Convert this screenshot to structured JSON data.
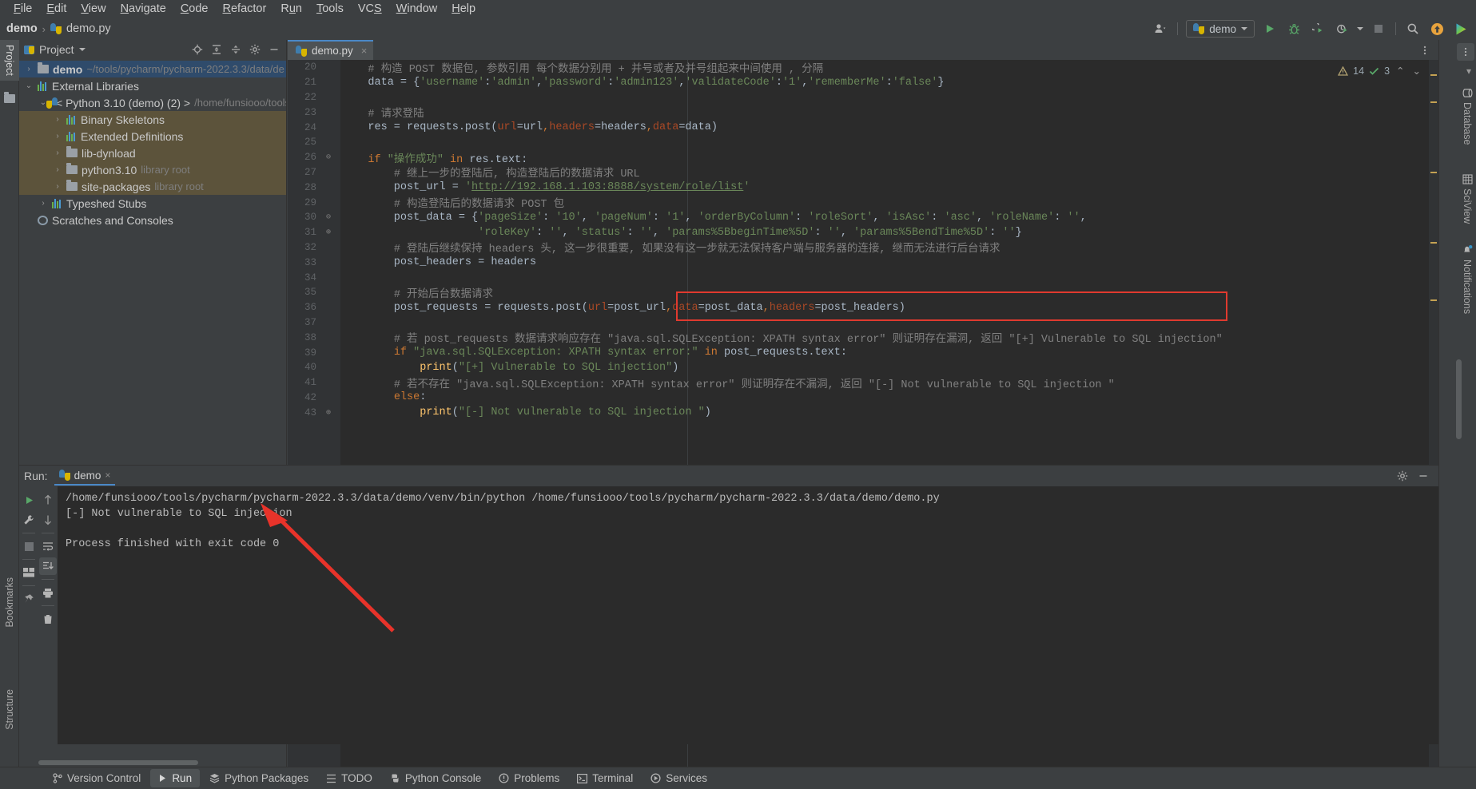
{
  "menu": {
    "items": [
      {
        "label": "File",
        "accel": "F"
      },
      {
        "label": "Edit",
        "accel": "E"
      },
      {
        "label": "View",
        "accel": "V"
      },
      {
        "label": "Navigate",
        "accel": "N"
      },
      {
        "label": "Code",
        "accel": "C"
      },
      {
        "label": "Refactor",
        "accel": "R"
      },
      {
        "label": "Run",
        "accel": "u"
      },
      {
        "label": "Tools",
        "accel": "T"
      },
      {
        "label": "VCS",
        "accel": "S"
      },
      {
        "label": "Window",
        "accel": "W"
      },
      {
        "label": "Help",
        "accel": "H"
      }
    ]
  },
  "breadcrumb": {
    "project": "demo",
    "separator": "›",
    "file": "demo.py"
  },
  "toolbar": {
    "account_icon": "account-icon",
    "run_config": "demo",
    "run_icon": "run-icon",
    "debug_icon": "debug-icon",
    "coverage_icon": "run-with-coverage-icon",
    "profile_icon": "profile-icon",
    "stop_icon": "stop-icon",
    "search_icon": "search-icon",
    "update_icon": "update-icon",
    "ai_icon": "ai-assistant-icon"
  },
  "left_strip": {
    "top": "Project",
    "bookmarks": "Bookmarks",
    "structure": "Structure"
  },
  "right_strip": {
    "database": "Database",
    "sciview": "SciView",
    "notifications": "Notifications"
  },
  "project_panel": {
    "title": "Project",
    "icons": [
      "locate-icon",
      "expand-all-icon",
      "collapse-all-icon",
      "settings-icon",
      "hide-icon"
    ],
    "tree": [
      {
        "indent": 0,
        "arrow": "›",
        "icon": "folder",
        "label": "demo",
        "sub": "~/tools/pycharm/pycharm-2022.3.3/data/de",
        "state": "selected",
        "bold": true
      },
      {
        "indent": 0,
        "arrow": "⌄",
        "icon": "library",
        "label": "External Libraries",
        "sub": "",
        "state": "normal",
        "bold": false
      },
      {
        "indent": 1,
        "arrow": "⌄",
        "icon": "python",
        "label": "< Python 3.10 (demo) (2) >",
        "sub": "/home/funsiooo/tools",
        "state": "normal",
        "bold": false
      },
      {
        "indent": 2,
        "arrow": "›",
        "icon": "library",
        "label": "Binary Skeletons",
        "sub": "",
        "state": "highlight",
        "bold": false
      },
      {
        "indent": 2,
        "arrow": "›",
        "icon": "library",
        "label": "Extended Definitions",
        "sub": "",
        "state": "highlight",
        "bold": false
      },
      {
        "indent": 2,
        "arrow": "›",
        "icon": "folder",
        "label": "lib-dynload",
        "sub": "",
        "state": "highlight",
        "bold": false
      },
      {
        "indent": 2,
        "arrow": "›",
        "icon": "folder",
        "label": "python3.10",
        "sub": "library root",
        "state": "highlight",
        "bold": false
      },
      {
        "indent": 2,
        "arrow": "›",
        "icon": "folder",
        "label": "site-packages",
        "sub": "library root",
        "state": "highlight",
        "bold": false
      },
      {
        "indent": 1,
        "arrow": "›",
        "icon": "library",
        "label": "Typeshed Stubs",
        "sub": "",
        "state": "normal",
        "bold": false
      },
      {
        "indent": 0,
        "arrow": "",
        "icon": "scratch",
        "label": "Scratches and Consoles",
        "sub": "",
        "state": "normal",
        "bold": false
      }
    ]
  },
  "editor": {
    "tab": "demo.py",
    "tab_close": "×",
    "inspection": {
      "warning_count": "14",
      "weak_count": "3",
      "up": "⌃",
      "down": "⌄"
    },
    "lines": [
      {
        "n": "20",
        "fold": "",
        "html": "<span class='com'>    # 构造 POST 数据包, 参数引用 每个数据分别用 + 并号或者及并号组起来中间使用 , 分隔 </span>"
      },
      {
        "n": "21",
        "fold": "",
        "html": "    data = {<span class='str'>'username'</span>:<span class='str'>'admin'</span>,<span class='str'>'password'</span>:<span class='str'>'admin123'</span>,<span class='str'>'validateCode'</span>:<span class='str'>'1'</span>,<span class='str'>'rememberMe'</span>:<span class='str'>'false'</span>}"
      },
      {
        "n": "22",
        "fold": "",
        "html": ""
      },
      {
        "n": "23",
        "fold": "",
        "html": "    <span class='com'># 请求登陆</span>"
      },
      {
        "n": "24",
        "fold": "",
        "html": "    res = requests.post(<span class='kwarg'>url</span>=url<span class='kw'>,</span><span class='kwarg'>headers</span>=headers<span class='kw'>,</span><span class='kwarg'>data</span>=data)"
      },
      {
        "n": "25",
        "fold": "",
        "html": ""
      },
      {
        "n": "26",
        "fold": "⊖",
        "html": "    <span class='kw'>if</span> <span class='str'>\"操作成功\"</span> <span class='kw'>in</span> res.text:"
      },
      {
        "n": "27",
        "fold": "",
        "html": "        <span class='com'># 继上一步的登陆后, 构造登陆后的数据请求 URL</span>"
      },
      {
        "n": "28",
        "fold": "",
        "html": "        post_url = <span class='str'>'</span><span class='url'>http://192.168.1.103:8888/system/role/list</span><span class='str'>'</span>"
      },
      {
        "n": "29",
        "fold": "",
        "html": "        <span class='com'># 构造登陆后的数据请求 POST 包</span>"
      },
      {
        "n": "30",
        "fold": "⊖",
        "html": "        post_data = {<span class='str'>'pageSize'</span>: <span class='str'>'10'</span>, <span class='str'>'pageNum'</span>: <span class='str'>'1'</span>, <span class='str'>'orderByColumn'</span>: <span class='str'>'roleSort'</span>, <span class='str'>'isAsc'</span>: <span class='str'>'asc'</span>, <span class='str'>'roleName'</span>: <span class='str'>''</span>,"
      },
      {
        "n": "31",
        "fold": "⊕",
        "html": "                     <span class='str'>'roleKey'</span>: <span class='str'>''</span>, <span class='str'>'status'</span>: <span class='str'>''</span>, <span class='str'>'params%5BbeginTime%5D'</span>: <span class='str'>''</span>, <span class='str'>'params%5BendTime%5D'</span>: <span class='str'>''</span>}"
      },
      {
        "n": "32",
        "fold": "",
        "html": "        <span class='com'># 登陆后继续保持 headers 头, 这一步很重要, 如果没有这一步就无法保持客户端与服务器的连接, 继而无法进行后台请求</span>"
      },
      {
        "n": "33",
        "fold": "",
        "html": "        post_headers = headers"
      },
      {
        "n": "34",
        "fold": "",
        "html": ""
      },
      {
        "n": "35",
        "fold": "",
        "html": "        <span class='com'># 开始后台数据请求</span>"
      },
      {
        "n": "36",
        "fold": "",
        "html": "        post_requests = requests.post(<span class='kwarg'>url</span>=post_url<span class='kw'>,</span><span class='kwarg'>data</span>=post_data<span class='kw'>,</span><span class='kwarg'>headers</span>=post_headers)"
      },
      {
        "n": "37",
        "fold": "",
        "html": ""
      },
      {
        "n": "38",
        "fold": "",
        "html": "        <span class='com'># 若 post_requests 数据请求响应存在 \"java.sql.SQLException: XPATH syntax error\" 则证明存在漏洞, 返回 \"[+] Vulnerable to SQL injection\"</span>"
      },
      {
        "n": "39",
        "fold": "",
        "html": "        <span class='kw'>if</span> <span class='str'>\"java.sql.SQLException: XPATH syntax error:\"</span> <span class='kw'>in</span> post_requests.text:"
      },
      {
        "n": "40",
        "fold": "",
        "html": "            <span class='fn'>print</span>(<span class='str'>\"[+] Vulnerable to SQL injection\"</span>)"
      },
      {
        "n": "41",
        "fold": "",
        "html": "        <span class='com'># 若不存在 \"java.sql.SQLException: XPATH syntax error\" 则证明存在不漏洞, 返回 \"[-] Not vulnerable to SQL injection \"</span>"
      },
      {
        "n": "42",
        "fold": "",
        "html": "        <span class='kw'>else</span>:"
      },
      {
        "n": "43",
        "fold": "⊕",
        "html": "            <span class='fn'>print</span>(<span class='str'>\"[-] Not vulnerable to SQL injection \"</span>)"
      }
    ]
  },
  "run_panel": {
    "label": "Run:",
    "tab": "demo",
    "tab_close": "×",
    "header_icons": [
      "settings-icon",
      "hide-icon"
    ],
    "tools_col1": [
      "rerun-icon",
      "settings-icon",
      "stop-icon",
      "layout-icon",
      "pin-icon"
    ],
    "tools_col2": [
      "up-icon",
      "down-icon",
      "soft-wrap-icon",
      "scroll-to-end-icon",
      "print-icon",
      "clear-all-icon"
    ],
    "console": [
      "/home/funsiooo/tools/pycharm/pycharm-2022.3.3/data/demo/venv/bin/python /home/funsiooo/tools/pycharm/pycharm-2022.3.3/data/demo/demo.py",
      "[-] Not vulnerable to SQL injection",
      "",
      "Process finished with exit code 0"
    ]
  },
  "status_bar": {
    "tabs": [
      {
        "label": "Version Control",
        "icon": "vcs-icon",
        "active": false
      },
      {
        "label": "Run",
        "icon": "run-icon",
        "active": true
      },
      {
        "label": "Python Packages",
        "icon": "packages-icon",
        "active": false
      },
      {
        "label": "TODO",
        "icon": "todo-icon",
        "active": false
      },
      {
        "label": "Python Console",
        "icon": "python-console-icon",
        "active": false
      },
      {
        "label": "Problems",
        "icon": "problems-icon",
        "active": false
      },
      {
        "label": "Terminal",
        "icon": "terminal-icon",
        "active": false
      },
      {
        "label": "Services",
        "icon": "services-icon",
        "active": false
      }
    ]
  },
  "annotation": {
    "arrow_color": "#e8332a",
    "highlight_color": "#e03a2f"
  }
}
